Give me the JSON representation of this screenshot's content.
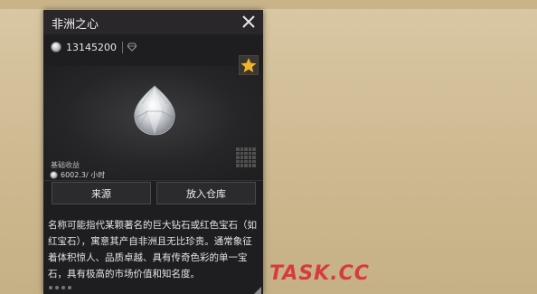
{
  "item": {
    "title": "非洲之心",
    "balance": "13145200",
    "income_label": "基础收益",
    "income_value": "6002.3/ 小时",
    "description": "名称可能指代某颗著名的巨大钻石或红色宝石（如红宝石），寓意其产自非洲且无比珍贵。通常象征着体积惊人、品质卓越、具有传奇色彩的单一宝石，具有极高的市场价值和知名度。"
  },
  "buttons": {
    "source": "来源",
    "store": "放入仓库"
  },
  "watermark": {
    "text": "TASK.CC"
  },
  "colors": {
    "panel": "#1e1d1f",
    "header": "#29272a",
    "star": "#f0b429",
    "background": "#cdb88f",
    "watermark": "#d73c3c"
  },
  "icons": {
    "close": "close-icon",
    "coin": "coin-icon",
    "gem": "gem-icon",
    "favorite": "star-icon",
    "grid": "grid-icon",
    "diamond": "diamond-icon"
  }
}
